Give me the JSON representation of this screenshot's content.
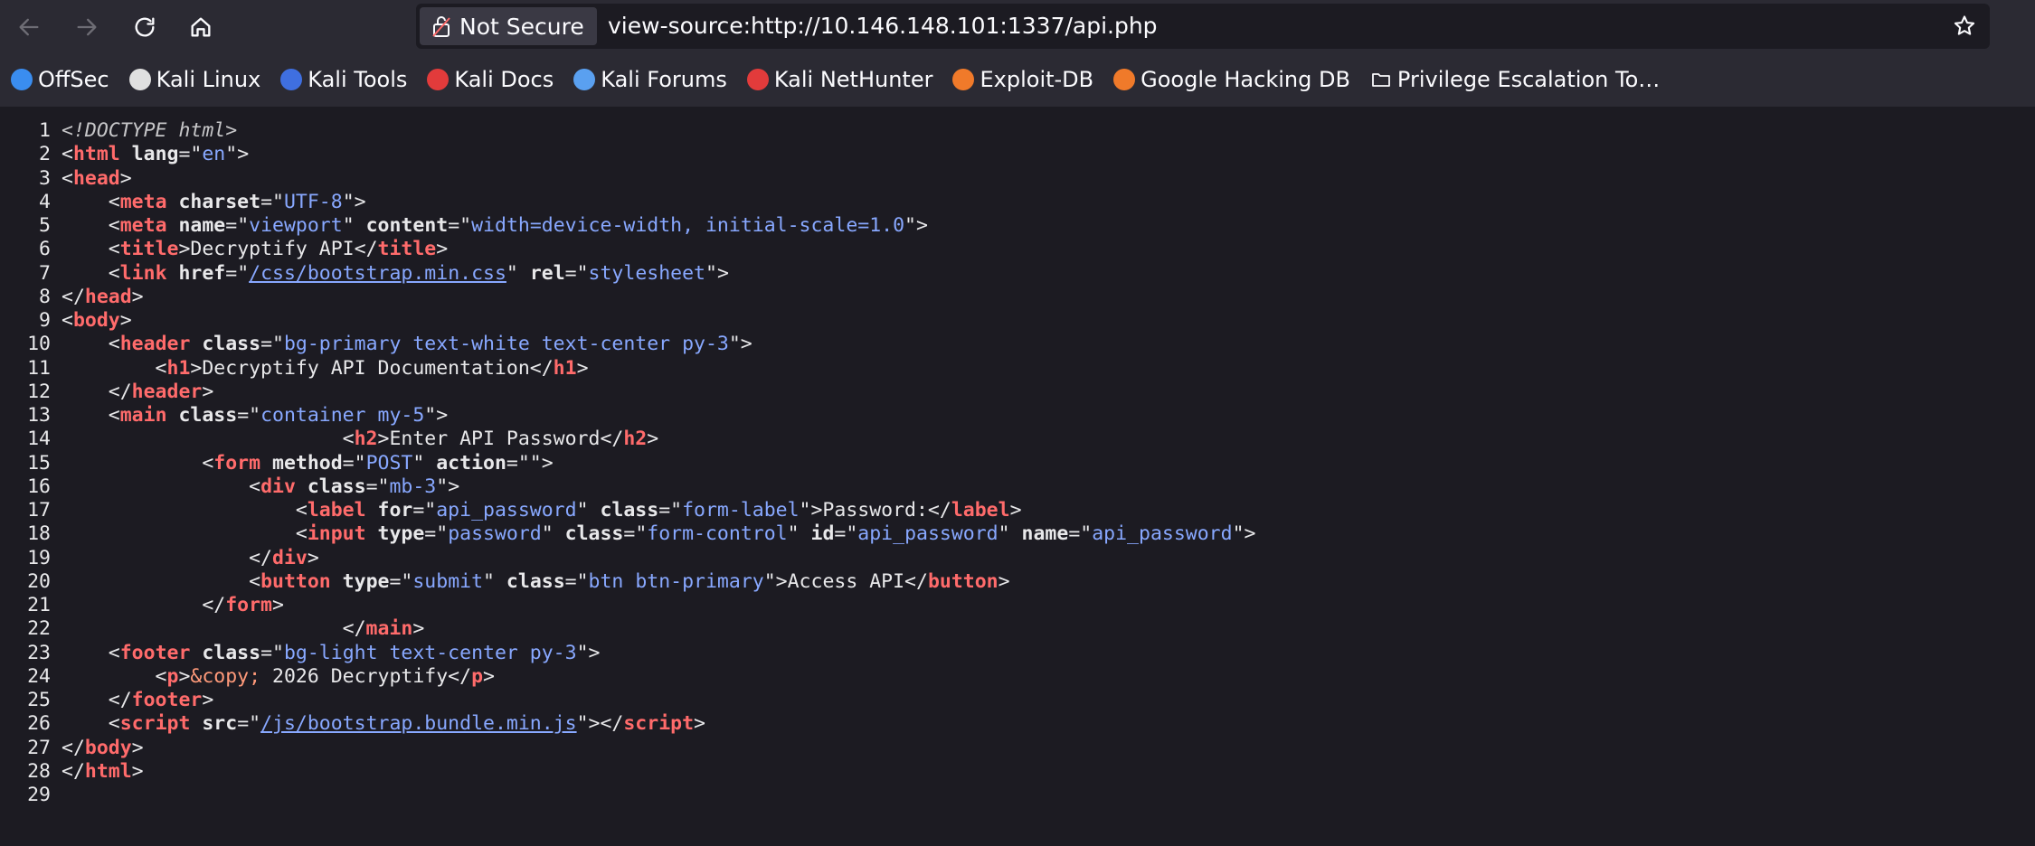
{
  "browser": {
    "security_label": "Not Secure",
    "url": "view-source:http://10.146.148.101:1337/api.php"
  },
  "bookmarks": [
    {
      "label": "OffSec",
      "icon": "offsec-icon",
      "color": "#3a8df0"
    },
    {
      "label": "Kali Linux",
      "icon": "kali-dragon-icon",
      "color": "#e0e0e0"
    },
    {
      "label": "Kali Tools",
      "icon": "kali-tools-icon",
      "color": "#3f6fe0"
    },
    {
      "label": "Kali Docs",
      "icon": "kali-docs-icon",
      "color": "#e23b3b"
    },
    {
      "label": "Kali Forums",
      "icon": "kali-forums-icon",
      "color": "#5aa0f0"
    },
    {
      "label": "Kali NetHunter",
      "icon": "kali-nethunter-icon",
      "color": "#e23b3b"
    },
    {
      "label": "Exploit-DB",
      "icon": "exploit-db-icon",
      "color": "#f07a2a"
    },
    {
      "label": "Google Hacking DB",
      "icon": "ghdb-icon",
      "color": "#f07a2a"
    },
    {
      "label": "Privilege Escalation To…",
      "icon": "folder-icon",
      "color": "#fbfbfe"
    }
  ],
  "source_lines": [
    [
      {
        "t": "doc",
        "s": "<!DOCTYPE html>"
      }
    ],
    [
      {
        "t": "src",
        "s": "<"
      },
      {
        "t": "tag",
        "s": "html"
      },
      {
        "t": "attr",
        "s": " lang"
      },
      {
        "t": "src",
        "s": "=\""
      },
      {
        "t": "val",
        "s": "en"
      },
      {
        "t": "src",
        "s": "\">"
      }
    ],
    [
      {
        "t": "src",
        "s": "<"
      },
      {
        "t": "tag",
        "s": "head"
      },
      {
        "t": "src",
        "s": ">"
      }
    ],
    [
      {
        "t": "src",
        "s": "    <"
      },
      {
        "t": "tag",
        "s": "meta"
      },
      {
        "t": "attr",
        "s": " charset"
      },
      {
        "t": "src",
        "s": "=\""
      },
      {
        "t": "val",
        "s": "UTF-8"
      },
      {
        "t": "src",
        "s": "\">"
      }
    ],
    [
      {
        "t": "src",
        "s": "    <"
      },
      {
        "t": "tag",
        "s": "meta"
      },
      {
        "t": "attr",
        "s": " name"
      },
      {
        "t": "src",
        "s": "=\""
      },
      {
        "t": "val",
        "s": "viewport"
      },
      {
        "t": "src",
        "s": "\""
      },
      {
        "t": "attr",
        "s": " content"
      },
      {
        "t": "src",
        "s": "=\""
      },
      {
        "t": "val",
        "s": "width=device-width, initial-scale=1.0"
      },
      {
        "t": "src",
        "s": "\">"
      }
    ],
    [
      {
        "t": "src",
        "s": "    <"
      },
      {
        "t": "tag",
        "s": "title"
      },
      {
        "t": "src",
        "s": ">Decryptify API</"
      },
      {
        "t": "tag",
        "s": "title"
      },
      {
        "t": "src",
        "s": ">"
      }
    ],
    [
      {
        "t": "src",
        "s": "    <"
      },
      {
        "t": "tag",
        "s": "link"
      },
      {
        "t": "attr",
        "s": " href"
      },
      {
        "t": "src",
        "s": "=\""
      },
      {
        "t": "link",
        "s": "/css/bootstrap.min.css"
      },
      {
        "t": "src",
        "s": "\""
      },
      {
        "t": "attr",
        "s": " rel"
      },
      {
        "t": "src",
        "s": "=\""
      },
      {
        "t": "val",
        "s": "stylesheet"
      },
      {
        "t": "src",
        "s": "\">"
      }
    ],
    [
      {
        "t": "src",
        "s": "</"
      },
      {
        "t": "tag",
        "s": "head"
      },
      {
        "t": "src",
        "s": ">"
      }
    ],
    [
      {
        "t": "src",
        "s": "<"
      },
      {
        "t": "tag",
        "s": "body"
      },
      {
        "t": "src",
        "s": ">"
      }
    ],
    [
      {
        "t": "src",
        "s": "    <"
      },
      {
        "t": "tag",
        "s": "header"
      },
      {
        "t": "attr",
        "s": " class"
      },
      {
        "t": "src",
        "s": "=\""
      },
      {
        "t": "val",
        "s": "bg-primary text-white text-center py-3"
      },
      {
        "t": "src",
        "s": "\">"
      }
    ],
    [
      {
        "t": "src",
        "s": "        <"
      },
      {
        "t": "tag",
        "s": "h1"
      },
      {
        "t": "src",
        "s": ">Decryptify API Documentation</"
      },
      {
        "t": "tag",
        "s": "h1"
      },
      {
        "t": "src",
        "s": ">"
      }
    ],
    [
      {
        "t": "src",
        "s": "    </"
      },
      {
        "t": "tag",
        "s": "header"
      },
      {
        "t": "src",
        "s": ">"
      }
    ],
    [
      {
        "t": "src",
        "s": "    <"
      },
      {
        "t": "tag",
        "s": "main"
      },
      {
        "t": "attr",
        "s": " class"
      },
      {
        "t": "src",
        "s": "=\""
      },
      {
        "t": "val",
        "s": "container my-5"
      },
      {
        "t": "src",
        "s": "\">"
      }
    ],
    [
      {
        "t": "src",
        "s": "                        <"
      },
      {
        "t": "tag",
        "s": "h2"
      },
      {
        "t": "src",
        "s": ">Enter API Password</"
      },
      {
        "t": "tag",
        "s": "h2"
      },
      {
        "t": "src",
        "s": ">"
      }
    ],
    [
      {
        "t": "src",
        "s": "            <"
      },
      {
        "t": "tag",
        "s": "form"
      },
      {
        "t": "attr",
        "s": " method"
      },
      {
        "t": "src",
        "s": "=\""
      },
      {
        "t": "val",
        "s": "POST"
      },
      {
        "t": "src",
        "s": "\""
      },
      {
        "t": "attr",
        "s": " action"
      },
      {
        "t": "src",
        "s": "=\"\">"
      }
    ],
    [
      {
        "t": "src",
        "s": "                <"
      },
      {
        "t": "tag",
        "s": "div"
      },
      {
        "t": "attr",
        "s": " class"
      },
      {
        "t": "src",
        "s": "=\""
      },
      {
        "t": "val",
        "s": "mb-3"
      },
      {
        "t": "src",
        "s": "\">"
      }
    ],
    [
      {
        "t": "src",
        "s": "                    <"
      },
      {
        "t": "tag",
        "s": "label"
      },
      {
        "t": "attr",
        "s": " for"
      },
      {
        "t": "src",
        "s": "=\""
      },
      {
        "t": "val",
        "s": "api_password"
      },
      {
        "t": "src",
        "s": "\""
      },
      {
        "t": "attr",
        "s": " class"
      },
      {
        "t": "src",
        "s": "=\""
      },
      {
        "t": "val",
        "s": "form-label"
      },
      {
        "t": "src",
        "s": "\">Password:</"
      },
      {
        "t": "tag",
        "s": "label"
      },
      {
        "t": "src",
        "s": ">"
      }
    ],
    [
      {
        "t": "src",
        "s": "                    <"
      },
      {
        "t": "tag",
        "s": "input"
      },
      {
        "t": "attr",
        "s": " type"
      },
      {
        "t": "src",
        "s": "=\""
      },
      {
        "t": "val",
        "s": "password"
      },
      {
        "t": "src",
        "s": "\""
      },
      {
        "t": "attr",
        "s": " class"
      },
      {
        "t": "src",
        "s": "=\""
      },
      {
        "t": "val",
        "s": "form-control"
      },
      {
        "t": "src",
        "s": "\""
      },
      {
        "t": "attr",
        "s": " id"
      },
      {
        "t": "src",
        "s": "=\""
      },
      {
        "t": "val",
        "s": "api_password"
      },
      {
        "t": "src",
        "s": "\""
      },
      {
        "t": "attr",
        "s": " name"
      },
      {
        "t": "src",
        "s": "=\""
      },
      {
        "t": "val",
        "s": "api_password"
      },
      {
        "t": "src",
        "s": "\">"
      }
    ],
    [
      {
        "t": "src",
        "s": "                </"
      },
      {
        "t": "tag",
        "s": "div"
      },
      {
        "t": "src",
        "s": ">"
      }
    ],
    [
      {
        "t": "src",
        "s": "                <"
      },
      {
        "t": "tag",
        "s": "button"
      },
      {
        "t": "attr",
        "s": " type"
      },
      {
        "t": "src",
        "s": "=\""
      },
      {
        "t": "val",
        "s": "submit"
      },
      {
        "t": "src",
        "s": "\""
      },
      {
        "t": "attr",
        "s": " class"
      },
      {
        "t": "src",
        "s": "=\""
      },
      {
        "t": "val",
        "s": "btn btn-primary"
      },
      {
        "t": "src",
        "s": "\">Access API</"
      },
      {
        "t": "tag",
        "s": "button"
      },
      {
        "t": "src",
        "s": ">"
      }
    ],
    [
      {
        "t": "src",
        "s": "            </"
      },
      {
        "t": "tag",
        "s": "form"
      },
      {
        "t": "src",
        "s": ">"
      }
    ],
    [
      {
        "t": "src",
        "s": "                        </"
      },
      {
        "t": "tag",
        "s": "main"
      },
      {
        "t": "src",
        "s": ">"
      }
    ],
    [
      {
        "t": "src",
        "s": "    <"
      },
      {
        "t": "tag",
        "s": "footer"
      },
      {
        "t": "attr",
        "s": " class"
      },
      {
        "t": "src",
        "s": "=\""
      },
      {
        "t": "val",
        "s": "bg-light text-center py-3"
      },
      {
        "t": "src",
        "s": "\">"
      }
    ],
    [
      {
        "t": "src",
        "s": "        <"
      },
      {
        "t": "tag",
        "s": "p"
      },
      {
        "t": "src",
        "s": ">"
      },
      {
        "t": "ent",
        "s": "&copy;"
      },
      {
        "t": "src",
        "s": " 2026 Decryptify</"
      },
      {
        "t": "tag",
        "s": "p"
      },
      {
        "t": "src",
        "s": ">"
      }
    ],
    [
      {
        "t": "src",
        "s": "    </"
      },
      {
        "t": "tag",
        "s": "footer"
      },
      {
        "t": "src",
        "s": ">"
      }
    ],
    [
      {
        "t": "src",
        "s": "    <"
      },
      {
        "t": "tag",
        "s": "script"
      },
      {
        "t": "attr",
        "s": " src"
      },
      {
        "t": "src",
        "s": "=\""
      },
      {
        "t": "link",
        "s": "/js/bootstrap.bundle.min.js"
      },
      {
        "t": "src",
        "s": "\"></"
      },
      {
        "t": "tag",
        "s": "script"
      },
      {
        "t": "src",
        "s": ">"
      }
    ],
    [
      {
        "t": "src",
        "s": "</"
      },
      {
        "t": "tag",
        "s": "body"
      },
      {
        "t": "src",
        "s": ">"
      }
    ],
    [
      {
        "t": "src",
        "s": "</"
      },
      {
        "t": "tag",
        "s": "html"
      },
      {
        "t": "src",
        "s": ">"
      }
    ],
    []
  ]
}
